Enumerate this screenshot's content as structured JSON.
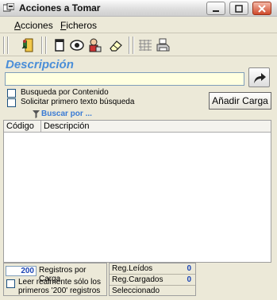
{
  "window": {
    "title": "Acciones a Tomar"
  },
  "menu": {
    "items": [
      {
        "label": "Acciones",
        "accel": "A",
        "rest": "cciones"
      },
      {
        "label": "Ficheros",
        "accel": "F",
        "rest": "icheros"
      }
    ]
  },
  "toolbar": {
    "icons": [
      "exit-door-icon",
      "document-icon",
      "view-eye-icon",
      "person-icon",
      "eraser-icon",
      "grid-icon",
      "printer-icon"
    ]
  },
  "search": {
    "section_title": "Descripción",
    "input_value": "",
    "option_content": "Busqueda por Contenido",
    "option_first_text": "Solicitar primero texto búsqueda",
    "add_button": "Añadir Carga",
    "search_by": "Buscar por ..."
  },
  "grid": {
    "columns": [
      "Código",
      "Descripción"
    ],
    "rows": []
  },
  "footer": {
    "records_per_load_value": "200",
    "records_per_load_label": "Registros por Carga",
    "read_only_label_line1": "Leer realmente sólo los",
    "read_only_label_line2": "primeros '200' registros",
    "stats": [
      {
        "label": "Reg.Leídos",
        "value": "0"
      },
      {
        "label": "Reg.Cargados",
        "value": "0"
      },
      {
        "label": "Seleccionado",
        "value": ""
      }
    ]
  },
  "colors": {
    "accent": "#4a8ed8",
    "input_bg": "#ffffe0",
    "value_blue": "#1b45b5"
  }
}
